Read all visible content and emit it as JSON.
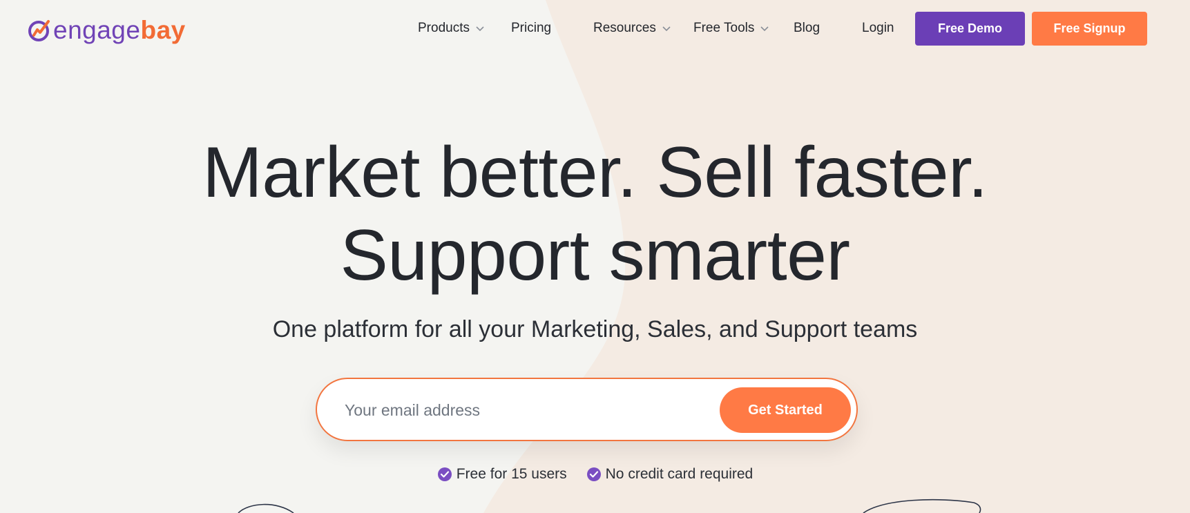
{
  "brand": {
    "logo_part1": "engage",
    "logo_part2": "bay",
    "primary_color": "#6b3fb6",
    "accent_color": "#ff7a45"
  },
  "nav": {
    "items": [
      {
        "label": "Products",
        "has_dropdown": true
      },
      {
        "label": "Pricing",
        "has_dropdown": false
      },
      {
        "label": "Resources",
        "has_dropdown": true
      },
      {
        "label": "Free Tools",
        "has_dropdown": true
      },
      {
        "label": "Blog",
        "has_dropdown": false
      },
      {
        "label": "Login",
        "has_dropdown": false
      }
    ],
    "demo_button": "Free Demo",
    "signup_button": "Free Signup"
  },
  "hero": {
    "headline_line1": "Market better. Sell faster.",
    "headline_line2": "Support smarter",
    "subheadline": "One platform for all your Marketing, Sales, and Support teams",
    "email_placeholder": "Your email address",
    "cta_label": "Get Started",
    "perks": [
      "Free for 15 users",
      "No credit card required"
    ]
  },
  "icons": {
    "logo": "engagebay-logo-icon",
    "dropdown": "chevron-down-icon",
    "perk": "check-circle-icon"
  }
}
